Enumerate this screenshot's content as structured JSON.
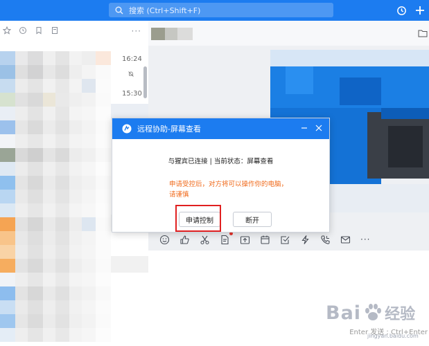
{
  "search": {
    "placeholder": "搜索 (Ctrl+Shift+F)"
  },
  "top_icons": [
    "history-icon",
    "plus-icon"
  ],
  "left_toolbar_icons": [
    "star-icon",
    "recent-icon",
    "bookmark-icon",
    "document-icon",
    "more-icon"
  ],
  "left_toolbar_more": "···",
  "chat_list": {
    "times": [
      "16:24",
      "15:30"
    ]
  },
  "chat": {
    "toolbar_icons": [
      "emoji-icon",
      "thumbs-up-icon",
      "scissors-icon",
      "file-icon",
      "upload-icon",
      "calendar-icon",
      "checkbox-icon",
      "lightning-icon",
      "phone-icon",
      "mail-icon",
      "more-icon"
    ],
    "more_label": "···",
    "send_hint": "Enter 发送 ; Ctrl+Enter"
  },
  "dialog": {
    "title": "远程协助-屏幕查看",
    "status": "与猩宾已连接 | 当前状态：屏幕查看",
    "warning": "申请受控后，对方将可以操作你的电脑，请谨慎",
    "request_button": "申请控制",
    "disconnect_button": "断开"
  },
  "watermark": {
    "brand_left": "Bai",
    "brand_right": "经验",
    "url": "jingyan.baidu.com"
  },
  "colors": {
    "accent": "#1c7cf0",
    "warning": "#f06a1b",
    "highlight": "#e02020"
  }
}
